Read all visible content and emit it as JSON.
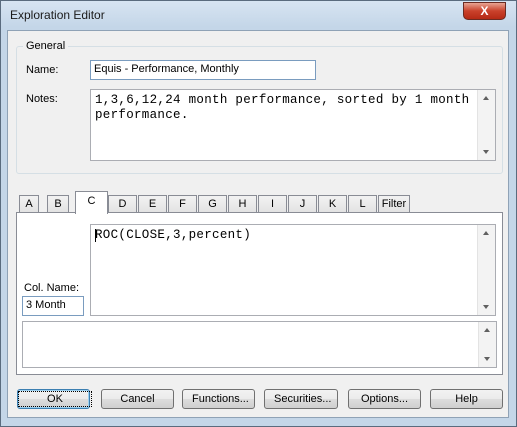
{
  "window": {
    "title": "Exploration Editor",
    "close_glyph": "X"
  },
  "general": {
    "legend": "General",
    "name_label": "Name:",
    "name_value": "Equis - Performance, Monthly",
    "notes_label": "Notes:",
    "notes_value": "1,3,6,12,24 month performance, sorted by 1 month performance."
  },
  "tabs": [
    {
      "label": "A"
    },
    {
      "label": "B"
    },
    {
      "label": "C"
    },
    {
      "label": "D"
    },
    {
      "label": "E"
    },
    {
      "label": "F"
    },
    {
      "label": "G"
    },
    {
      "label": "H"
    },
    {
      "label": "I"
    },
    {
      "label": "J"
    },
    {
      "label": "K"
    },
    {
      "label": "L"
    },
    {
      "label": "Filter"
    }
  ],
  "active_tab": "C",
  "column": {
    "formula": "ROC(CLOSE,3,percent)",
    "col_name_label": "Col. Name:",
    "col_name_value": "3 Month",
    "secondary_text": ""
  },
  "buttons": {
    "ok": "OK",
    "cancel": "Cancel",
    "functions": "Functions...",
    "securities": "Securities...",
    "options": "Options...",
    "help": "Help"
  }
}
